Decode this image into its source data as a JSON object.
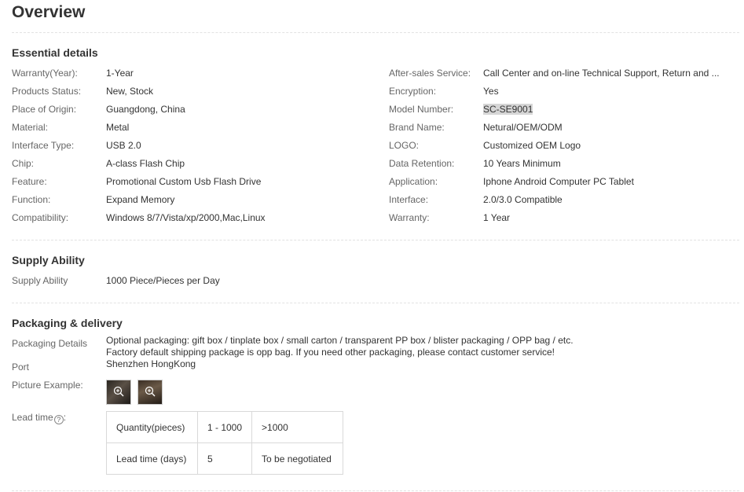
{
  "page": {
    "title": "Overview"
  },
  "essential": {
    "title": "Essential details",
    "left": [
      {
        "label": "Warranty(Year):",
        "value": "1-Year"
      },
      {
        "label": "Products Status:",
        "value": "New, Stock"
      },
      {
        "label": "Place of Origin:",
        "value": "Guangdong, China"
      },
      {
        "label": "Material:",
        "value": "Metal"
      },
      {
        "label": "Interface Type:",
        "value": "USB 2.0"
      },
      {
        "label": "Chip:",
        "value": "A-class Flash Chip"
      },
      {
        "label": "Feature:",
        "value": "Promotional Custom Usb Flash Drive"
      },
      {
        "label": "Function:",
        "value": "Expand Memory"
      },
      {
        "label": "Compatibility:",
        "value": "Windows 8/7/Vista/xp/2000,Mac,Linux"
      }
    ],
    "right": [
      {
        "label": "After-sales Service:",
        "value": "Call Center and on-line Technical Support, Return and ..."
      },
      {
        "label": "Encryption:",
        "value": "Yes"
      },
      {
        "label": "Model Number:",
        "value": "SC-SE9001"
      },
      {
        "label": "Brand Name:",
        "value": "Netural/OEM/ODM"
      },
      {
        "label": "LOGO:",
        "value": "Customized OEM Logo"
      },
      {
        "label": "Data Retention:",
        "value": "10 Years Minimum"
      },
      {
        "label": "Application:",
        "value": "Iphone Android Computer PC Tablet"
      },
      {
        "label": "Interface:",
        "value": "2.0/3.0 Compatible"
      },
      {
        "label": "Warranty:",
        "value": "1 Year"
      }
    ]
  },
  "supply": {
    "title": "Supply Ability",
    "label": "Supply Ability",
    "value": "1000 Piece/Pieces per Day"
  },
  "packaging": {
    "title": "Packaging & delivery",
    "details_label": "Packaging Details",
    "details_line1": "Optional packaging: gift box / tinplate box / small carton / transparent PP box / blister packaging / OPP bag / etc.",
    "details_line2": "Factory default shipping package is opp bag. If you need other packaging, please contact customer service!",
    "port_label": "Port",
    "port_value": "Shenzhen HongKong",
    "picture_label": "Picture Example:",
    "lead_label": "Lead time",
    "lead_help": "?",
    "lead_colon": ":",
    "lead_table": {
      "row1": [
        "Quantity(pieces)",
        "1 - 1000",
        ">1000"
      ],
      "row2": [
        "Lead time (days)",
        "5",
        "To be negotiated"
      ]
    }
  },
  "colors": {
    "text": "#333333",
    "label": "#666666",
    "divider": "#e2e2e2",
    "highlight": "#d6d6d6"
  }
}
